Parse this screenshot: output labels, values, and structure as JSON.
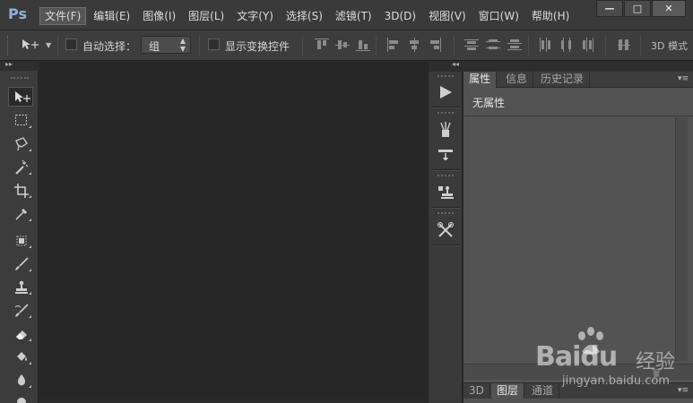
{
  "app": {
    "logo": "Ps"
  },
  "menu": {
    "items": [
      "文件(F)",
      "编辑(E)",
      "图像(I)",
      "图层(L)",
      "文字(Y)",
      "选择(S)",
      "滤镜(T)",
      "3D(D)",
      "视图(V)",
      "窗口(W)",
      "帮助(H)"
    ],
    "active_index": 0
  },
  "window_controls": {
    "minimize": "—",
    "maximize": "□",
    "close": "✕"
  },
  "options_bar": {
    "auto_select_label": "自动选择：",
    "auto_select_value": "组",
    "show_transform_label": "显示变换控件",
    "mode_3d_label": "3D 模式"
  },
  "left_toolbar": {
    "tools": [
      "move-tool",
      "marquee-tool",
      "lasso-tool",
      "magic-wand-tool",
      "crop-tool",
      "eyedropper-tool",
      "healing-brush-tool",
      "brush-tool",
      "clone-stamp-tool",
      "history-brush-tool",
      "eraser-tool",
      "paint-bucket-tool",
      "blur-tool",
      "dodge-tool"
    ],
    "active_tool": "move-tool"
  },
  "dock": {
    "buttons": [
      "play-icon",
      "brush-presets-icon",
      "brush-settings-icon",
      "clone-source-icon",
      "tool-presets-icon"
    ]
  },
  "right_panel": {
    "tabs": [
      "属性",
      "信息",
      "历史记录"
    ],
    "active_tab": 0,
    "no_properties": "无属性",
    "bottom_tabs": [
      "3D",
      "图层",
      "通道"
    ],
    "bottom_active_tab": 1
  },
  "watermark": {
    "brand": "Baidu",
    "cn": "经验",
    "url": "jingyan.baidu.com"
  }
}
